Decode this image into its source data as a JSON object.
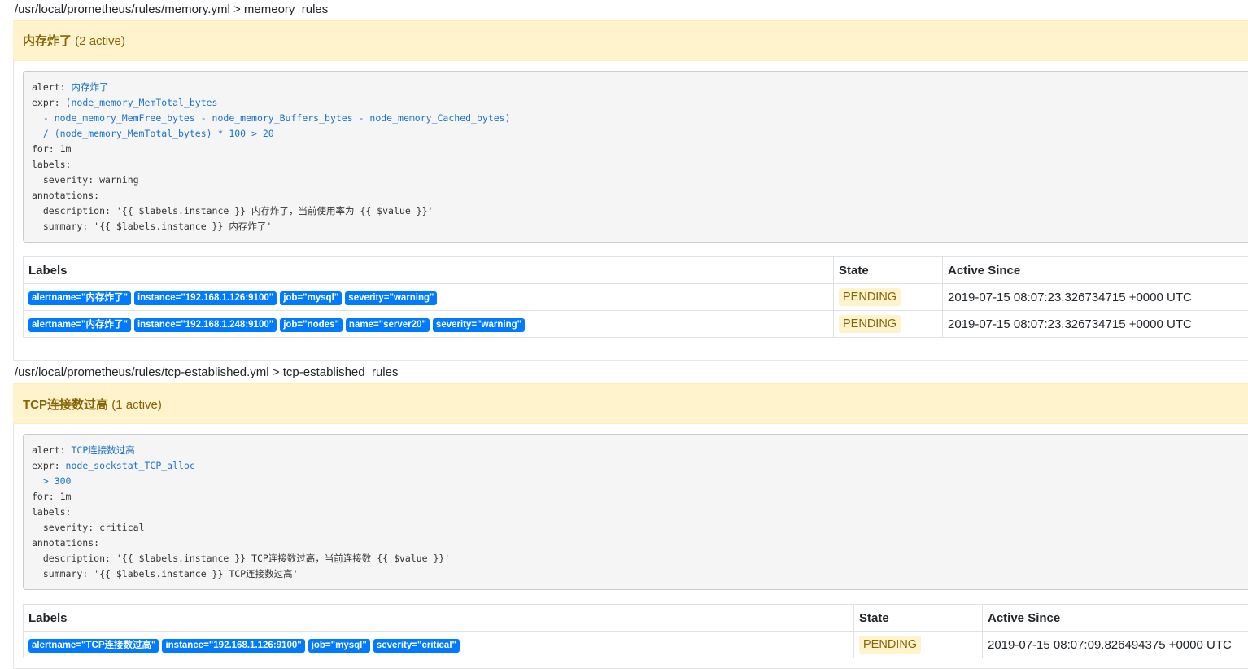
{
  "groups": [
    {
      "path": "/usr/local/prometheus/rules/memory.yml > memeory_rules",
      "rule": {
        "name": "内存炸了",
        "active_count": "(2 active)",
        "definition": [
          {
            "k": "alert: ",
            "v": "内存炸了"
          },
          {
            "k": "expr: ",
            "v": "(node_memory_MemTotal_bytes"
          },
          {
            "k": "",
            "v": "  - node_memory_MemFree_bytes - node_memory_Buffers_bytes - node_memory_Cached_bytes)"
          },
          {
            "k": "",
            "v": "  / (node_memory_MemTotal_bytes) * 100 > 20"
          },
          {
            "k": "for: 1m",
            "v": ""
          },
          {
            "k": "labels:",
            "v": ""
          },
          {
            "k": "  severity: warning",
            "v": ""
          },
          {
            "k": "annotations:",
            "v": ""
          },
          {
            "k": "  description: '{{ $labels.instance }} 内存炸了，当前使用率为 {{ $value }}'",
            "v": ""
          },
          {
            "k": "  summary: '{{ $labels.instance }} 内存炸了'",
            "v": ""
          }
        ],
        "table": {
          "headers": [
            "Labels",
            "State",
            "Active Since"
          ],
          "rows": [
            {
              "labels": [
                "alertname=\"内存炸了\"",
                "instance=\"192.168.1.126:9100\"",
                "job=\"mysql\"",
                "severity=\"warning\""
              ],
              "state": "PENDING",
              "active_since": "2019-07-15 08:07:23.326734715 +0000 UTC"
            },
            {
              "labels": [
                "alertname=\"内存炸了\"",
                "instance=\"192.168.1.248:9100\"",
                "job=\"nodes\"",
                "name=\"server20\"",
                "severity=\"warning\""
              ],
              "state": "PENDING",
              "active_since": "2019-07-15 08:07:23.326734715 +0000 UTC"
            }
          ]
        }
      }
    },
    {
      "path": "/usr/local/prometheus/rules/tcp-established.yml > tcp-established_rules",
      "rule": {
        "name": "TCP连接数过高",
        "active_count": "(1 active)",
        "definition": [
          {
            "k": "alert: ",
            "v": "TCP连接数过高"
          },
          {
            "k": "expr: ",
            "v": "node_sockstat_TCP_alloc"
          },
          {
            "k": "",
            "v": "  > 300"
          },
          {
            "k": "for: 1m",
            "v": ""
          },
          {
            "k": "labels:",
            "v": ""
          },
          {
            "k": "  severity: critical",
            "v": ""
          },
          {
            "k": "annotations:",
            "v": ""
          },
          {
            "k": "  description: '{{ $labels.instance }} TCP连接数过高，当前连接数 {{ $value }}'",
            "v": ""
          },
          {
            "k": "  summary: '{{ $labels.instance }} TCP连接数过高'",
            "v": ""
          }
        ],
        "table": {
          "headers": [
            "Labels",
            "State",
            "Active Since"
          ],
          "rows": [
            {
              "labels": [
                "alertname=\"TCP连接数过高\"",
                "instance=\"192.168.1.126:9100\"",
                "job=\"mysql\"",
                "severity=\"critical\""
              ],
              "state": "PENDING",
              "active_since": "2019-07-15 08:07:09.826494375 +0000 UTC"
            }
          ]
        }
      }
    }
  ],
  "colors": {
    "header_bg": "#fff3cd",
    "header_text": "#856404",
    "label_badge": "#007bff",
    "code_value": "#1a73c8"
  }
}
